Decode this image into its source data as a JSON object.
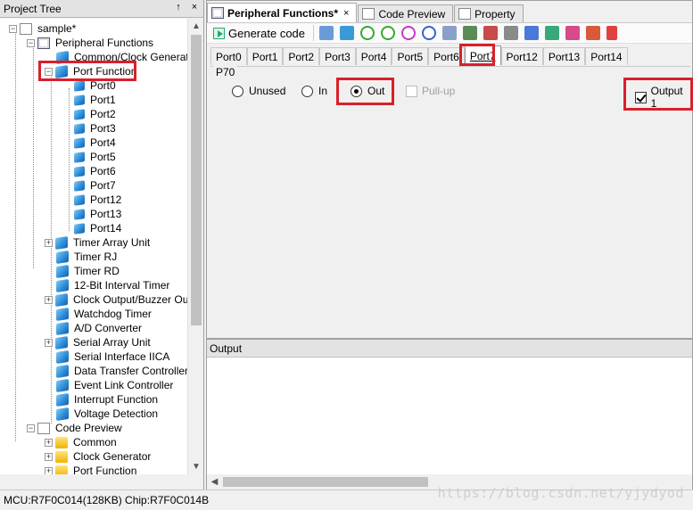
{
  "project_tree": {
    "title": "Project Tree",
    "pin_label": "↑",
    "close_label": "×",
    "root": "sample*",
    "peripheral_functions": "Peripheral Functions",
    "items": [
      "Common/Clock Generator",
      "Port Function",
      "Port0",
      "Port1",
      "Port2",
      "Port3",
      "Port4",
      "Port5",
      "Port6",
      "Port7",
      "Port12",
      "Port13",
      "Port14",
      "Timer Array Unit",
      "Timer RJ",
      "Timer RD",
      "12-Bit Interval Timer",
      "Clock Output/Buzzer Output",
      "Watchdog Timer",
      "A/D Converter",
      "Serial Array Unit",
      "Serial Interface IICA",
      "Data Transfer Controller",
      "Event Link Controller",
      "Interrupt Function",
      "Voltage Detection"
    ],
    "code_preview": "Code Preview",
    "code_items": [
      "Common",
      "Clock Generator",
      "Port Function"
    ]
  },
  "editor": {
    "doc_tabs": [
      {
        "label": "Peripheral Functions*",
        "active": true
      },
      {
        "label": "Code Preview",
        "active": false
      },
      {
        "label": "Property",
        "active": false
      }
    ],
    "close_label": "×",
    "generate_code": "Generate code",
    "port_tabs": [
      "Port0",
      "Port1",
      "Port2",
      "Port3",
      "Port4",
      "Port5",
      "Port6",
      "Port7",
      "Port12",
      "Port13",
      "Port14"
    ],
    "active_port_tab": "Port7",
    "group_label": "P70",
    "options": {
      "unused": "Unused",
      "in": "In",
      "out": "Out",
      "pullup": "Pull-up",
      "output1": "Output 1"
    },
    "selected_option": "Out",
    "output1_checked": true,
    "pullup_enabled": false
  },
  "output_pane": {
    "title": "Output"
  },
  "status_bar": {
    "text": "MCU:R7F0C014(128KB) Chip:R7F0C014B"
  },
  "watermark": "https://blog.csdn.net/yjydyod",
  "colors": {
    "highlight": "#d9202a"
  },
  "icons": {
    "tree_item": "cube-icon",
    "chip": "chip-icon",
    "code_preview": "document-icon",
    "code_item": "folder-icon"
  }
}
